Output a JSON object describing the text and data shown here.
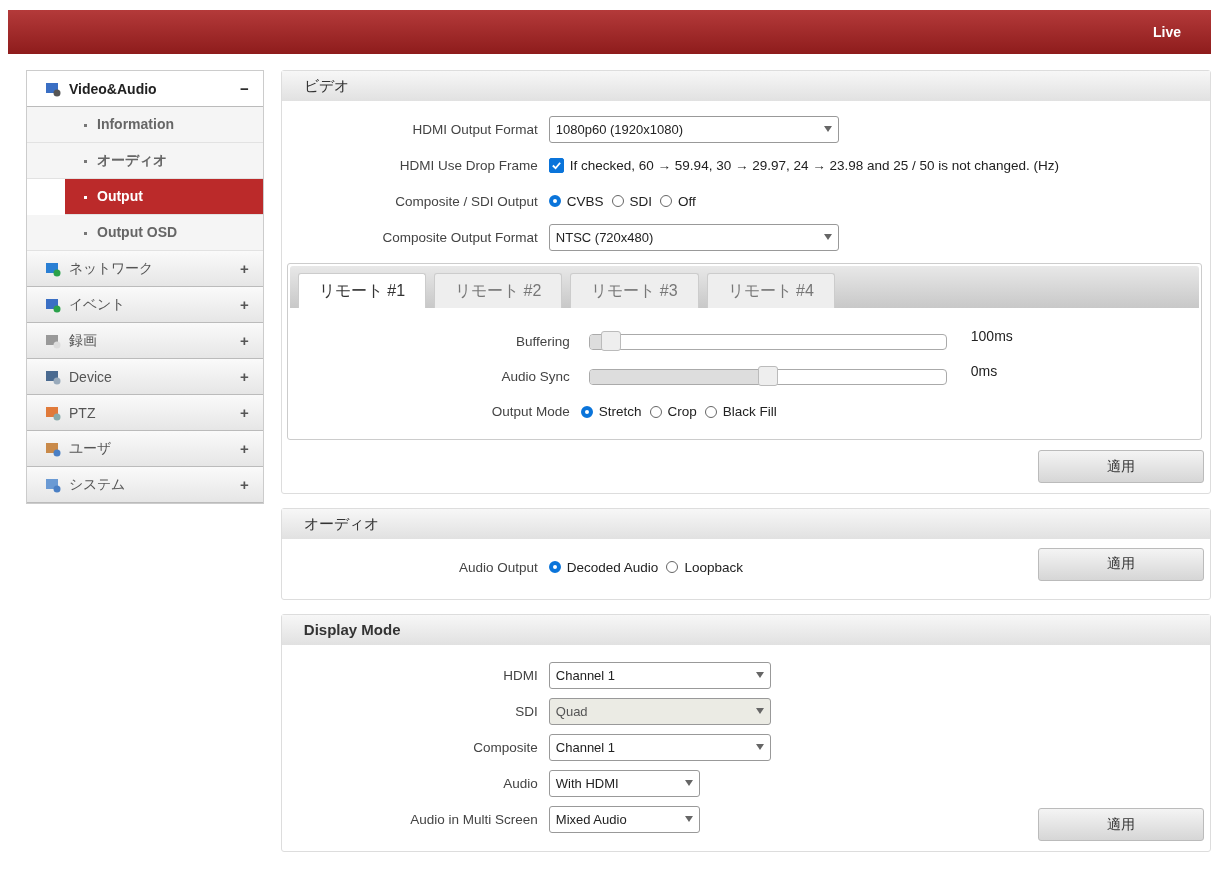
{
  "header": {
    "live_link": "Live"
  },
  "sidebar": [
    {
      "label": "Video&Audio",
      "expanded": true,
      "toggle": "−",
      "children": [
        {
          "label": "Information",
          "selected": false
        },
        {
          "label": "オーディオ",
          "selected": false
        },
        {
          "label": "Output",
          "selected": true
        },
        {
          "label": "Output OSD",
          "selected": false
        }
      ]
    },
    {
      "label": "ネットワーク",
      "expanded": false,
      "toggle": "+"
    },
    {
      "label": "イベント",
      "expanded": false,
      "toggle": "+"
    },
    {
      "label": "録画",
      "expanded": false,
      "toggle": "+"
    },
    {
      "label": "Device",
      "expanded": false,
      "toggle": "+"
    },
    {
      "label": "PTZ",
      "expanded": false,
      "toggle": "+"
    },
    {
      "label": "ユーザ",
      "expanded": false,
      "toggle": "+"
    },
    {
      "label": "システム",
      "expanded": false,
      "toggle": "+"
    }
  ],
  "video": {
    "title": "ビデオ",
    "rows": [
      {
        "kind": "select",
        "label": "HDMI Output Format",
        "value": "1080p60 (1920x1080)",
        "disabled": false
      },
      {
        "kind": "checkbox",
        "label": "HDMI Use Drop Frame",
        "checked": true,
        "text": "If checked, 60 → 59.94, 30 → 29.97, 24 → 23.98 and 25 / 50 is not changed. (Hz)"
      },
      {
        "kind": "radio",
        "label": "Composite / SDI Output",
        "options": [
          {
            "label": "CVBS",
            "selected": true
          },
          {
            "label": "SDI",
            "selected": false
          },
          {
            "label": "Off",
            "selected": false
          }
        ]
      },
      {
        "kind": "select",
        "label": "Composite Output Format",
        "value": "NTSC (720x480)",
        "disabled": false
      }
    ],
    "tabs": [
      {
        "label": "リモート #1",
        "selected": true
      },
      {
        "label": "リモート #2",
        "selected": false
      },
      {
        "label": "リモート #3",
        "selected": false
      },
      {
        "label": "リモート #4",
        "selected": false
      }
    ],
    "remote_rows": [
      {
        "kind": "slider",
        "label": "Buffering",
        "level": 0.06,
        "reading": "100ms"
      },
      {
        "kind": "slider",
        "label": "Audio Sync",
        "level": 0.5,
        "reading": "0ms"
      },
      {
        "kind": "radio",
        "label": "Output Mode",
        "options": [
          {
            "label": "Stretch",
            "selected": true
          },
          {
            "label": "Crop",
            "selected": false
          },
          {
            "label": "Black Fill",
            "selected": false
          }
        ]
      }
    ],
    "apply": "適用"
  },
  "audio": {
    "title": "オーディオ",
    "rows": [
      {
        "kind": "radio",
        "label": "Audio Output",
        "options": [
          {
            "label": "Decoded Audio",
            "selected": true
          },
          {
            "label": "Loopback",
            "selected": false
          }
        ]
      }
    ],
    "apply": "適用"
  },
  "display": {
    "title": "Display Mode",
    "rows": [
      {
        "kind": "select",
        "label": "HDMI",
        "value": "Channel 1",
        "disabled": false
      },
      {
        "kind": "select",
        "label": "SDI",
        "value": "Quad",
        "disabled": true
      },
      {
        "kind": "select",
        "label": "Composite",
        "value": "Channel 1",
        "disabled": false
      },
      {
        "kind": "select",
        "label": "Audio",
        "value": "With HDMI",
        "disabled": false
      },
      {
        "kind": "select",
        "label": "Audio in Multi Screen",
        "value": "Mixed Audio",
        "disabled": false
      }
    ],
    "apply": "適用"
  }
}
